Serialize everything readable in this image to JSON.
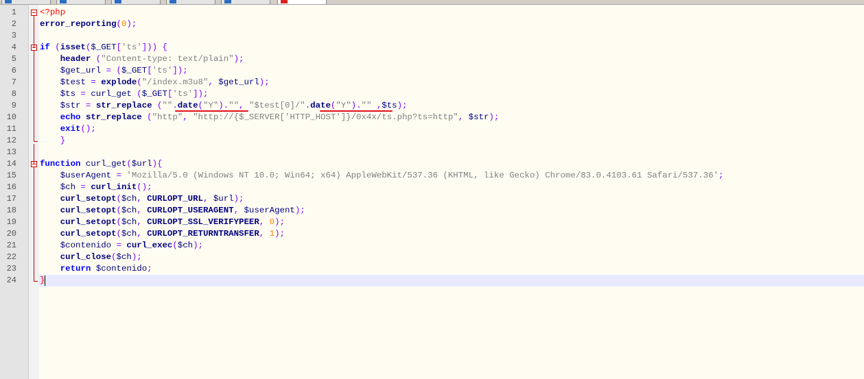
{
  "editor": {
    "line_numbers": [
      "1",
      "2",
      "3",
      "4",
      "5",
      "6",
      "7",
      "8",
      "9",
      "10",
      "11",
      "12",
      "13",
      "14",
      "15",
      "16",
      "17",
      "18",
      "19",
      "20",
      "21",
      "22",
      "23",
      "24"
    ],
    "lines": [
      [
        {
          "t": "<?php",
          "c": "tag"
        }
      ],
      [
        {
          "t": "error_reporting",
          "c": "bold"
        },
        {
          "t": "(",
          "c": "op"
        },
        {
          "t": "0",
          "c": "num"
        },
        {
          "t": ");",
          "c": "op"
        }
      ],
      [],
      [
        {
          "t": "if",
          "c": "kw"
        },
        {
          "t": " (",
          "c": "op"
        },
        {
          "t": "isset",
          "c": "bold"
        },
        {
          "t": "(",
          "c": "op"
        },
        {
          "t": "$_GET",
          "c": "var"
        },
        {
          "t": "[",
          "c": "op"
        },
        {
          "t": "'ts'",
          "c": "str"
        },
        {
          "t": "])) {",
          "c": "op"
        }
      ],
      [
        {
          "t": "    "
        },
        {
          "t": "header",
          "c": "bold"
        },
        {
          "t": " (",
          "c": "op"
        },
        {
          "t": "\"Content-type: text/plain\"",
          "c": "str"
        },
        {
          "t": ");",
          "c": "op"
        }
      ],
      [
        {
          "t": "    "
        },
        {
          "t": "$get_url",
          "c": "var"
        },
        {
          "t": " = (",
          "c": "op"
        },
        {
          "t": "$_GET",
          "c": "var"
        },
        {
          "t": "[",
          "c": "op"
        },
        {
          "t": "'ts'",
          "c": "str"
        },
        {
          "t": "]);",
          "c": "op"
        }
      ],
      [
        {
          "t": "    "
        },
        {
          "t": "$test",
          "c": "var"
        },
        {
          "t": " = ",
          "c": "op"
        },
        {
          "t": "explode",
          "c": "bold"
        },
        {
          "t": "(",
          "c": "op"
        },
        {
          "t": "\"/index.m3u8\"",
          "c": "str"
        },
        {
          "t": ", ",
          "c": "op"
        },
        {
          "t": "$get_url",
          "c": "var"
        },
        {
          "t": ");",
          "c": "op"
        }
      ],
      [
        {
          "t": "    "
        },
        {
          "t": "$ts",
          "c": "var"
        },
        {
          "t": " = ",
          "c": "op"
        },
        {
          "t": "curl_get",
          "c": "fn"
        },
        {
          "t": " (",
          "c": "op"
        },
        {
          "t": "$_GET",
          "c": "var"
        },
        {
          "t": "[",
          "c": "op"
        },
        {
          "t": "'ts'",
          "c": "str"
        },
        {
          "t": "]);",
          "c": "op"
        }
      ],
      [
        {
          "t": "    "
        },
        {
          "t": "$str",
          "c": "var"
        },
        {
          "t": " = ",
          "c": "op"
        },
        {
          "t": "str_replace",
          "c": "bold"
        },
        {
          "t": " (",
          "c": "op"
        },
        {
          "t": "\"\"",
          "c": "str"
        },
        {
          "t": ".",
          "c": "op"
        },
        {
          "t": "date",
          "c": "bold"
        },
        {
          "t": "(",
          "c": "op"
        },
        {
          "t": "\"Y\"",
          "c": "str"
        },
        {
          "t": ").",
          "c": "op"
        },
        {
          "t": "\"\"",
          "c": "str"
        },
        {
          "t": ", ",
          "c": "op"
        },
        {
          "t": "\"$test[0]/\"",
          "c": "str"
        },
        {
          "t": ".",
          "c": "op"
        },
        {
          "t": "date",
          "c": "bold"
        },
        {
          "t": "(",
          "c": "op"
        },
        {
          "t": "\"Y\"",
          "c": "str"
        },
        {
          "t": ").",
          "c": "op"
        },
        {
          "t": "\"\"",
          "c": "str"
        },
        {
          "t": " ,",
          "c": "op"
        },
        {
          "t": "$ts",
          "c": "var"
        },
        {
          "t": ");",
          "c": "op"
        }
      ],
      [
        {
          "t": "    "
        },
        {
          "t": "echo",
          "c": "kw"
        },
        {
          "t": " "
        },
        {
          "t": "str_replace",
          "c": "bold"
        },
        {
          "t": " (",
          "c": "op"
        },
        {
          "t": "\"http\"",
          "c": "str"
        },
        {
          "t": ", ",
          "c": "op"
        },
        {
          "t": "\"http://{$_SERVER['HTTP_HOST']}/0x4x/ts.php?ts=http\"",
          "c": "str"
        },
        {
          "t": ", ",
          "c": "op"
        },
        {
          "t": "$str",
          "c": "var"
        },
        {
          "t": ");",
          "c": "op"
        }
      ],
      [
        {
          "t": "    "
        },
        {
          "t": "exit",
          "c": "kw"
        },
        {
          "t": "();",
          "c": "op"
        }
      ],
      [
        {
          "t": "    "
        },
        {
          "t": "}",
          "c": "op"
        }
      ],
      [],
      [
        {
          "t": "function",
          "c": "kw"
        },
        {
          "t": " curl_get",
          "c": "fn"
        },
        {
          "t": "(",
          "c": "op"
        },
        {
          "t": "$url",
          "c": "var"
        },
        {
          "t": "){",
          "c": "op"
        }
      ],
      [
        {
          "t": "    "
        },
        {
          "t": "$userAgent",
          "c": "var"
        },
        {
          "t": " = ",
          "c": "op"
        },
        {
          "t": "'Mozilla/5.0 (Windows NT 10.0; Win64; x64) AppleWebKit/537.36 (KHTML, like Gecko) Chrome/83.0.4103.61 Safari/537.36'",
          "c": "str"
        },
        {
          "t": ";",
          "c": "op"
        }
      ],
      [
        {
          "t": "    "
        },
        {
          "t": "$ch",
          "c": "var"
        },
        {
          "t": " = ",
          "c": "op"
        },
        {
          "t": "curl_init",
          "c": "bold"
        },
        {
          "t": "();",
          "c": "op"
        }
      ],
      [
        {
          "t": "    "
        },
        {
          "t": "curl_setopt",
          "c": "bold"
        },
        {
          "t": "(",
          "c": "op"
        },
        {
          "t": "$ch",
          "c": "var"
        },
        {
          "t": ", ",
          "c": "op"
        },
        {
          "t": "CURLOPT_URL",
          "c": "bold"
        },
        {
          "t": ", ",
          "c": "op"
        },
        {
          "t": "$url",
          "c": "var"
        },
        {
          "t": ");",
          "c": "op"
        }
      ],
      [
        {
          "t": "    "
        },
        {
          "t": "curl_setopt",
          "c": "bold"
        },
        {
          "t": "(",
          "c": "op"
        },
        {
          "t": "$ch",
          "c": "var"
        },
        {
          "t": ", ",
          "c": "op"
        },
        {
          "t": "CURLOPT_USERAGENT",
          "c": "bold"
        },
        {
          "t": ", ",
          "c": "op"
        },
        {
          "t": "$userAgent",
          "c": "var"
        },
        {
          "t": ");",
          "c": "op"
        }
      ],
      [
        {
          "t": "    "
        },
        {
          "t": "curl_setopt",
          "c": "bold"
        },
        {
          "t": "(",
          "c": "op"
        },
        {
          "t": "$ch",
          "c": "var"
        },
        {
          "t": ", ",
          "c": "op"
        },
        {
          "t": "CURLOPT_SSL_VERIFYPEER",
          "c": "bold"
        },
        {
          "t": ", ",
          "c": "op"
        },
        {
          "t": "0",
          "c": "num"
        },
        {
          "t": ");",
          "c": "op"
        }
      ],
      [
        {
          "t": "    "
        },
        {
          "t": "curl_setopt",
          "c": "bold"
        },
        {
          "t": "(",
          "c": "op"
        },
        {
          "t": "$ch",
          "c": "var"
        },
        {
          "t": ", ",
          "c": "op"
        },
        {
          "t": "CURLOPT_RETURNTRANSFER",
          "c": "bold"
        },
        {
          "t": ", ",
          "c": "op"
        },
        {
          "t": "1",
          "c": "num"
        },
        {
          "t": ");",
          "c": "op"
        }
      ],
      [
        {
          "t": "    "
        },
        {
          "t": "$contenido",
          "c": "var"
        },
        {
          "t": " = ",
          "c": "op"
        },
        {
          "t": "curl_exec",
          "c": "bold"
        },
        {
          "t": "(",
          "c": "op"
        },
        {
          "t": "$ch",
          "c": "var"
        },
        {
          "t": ");",
          "c": "op"
        }
      ],
      [
        {
          "t": "    "
        },
        {
          "t": "curl_close",
          "c": "bold"
        },
        {
          "t": "(",
          "c": "op"
        },
        {
          "t": "$ch",
          "c": "var"
        },
        {
          "t": ");",
          "c": "op"
        }
      ],
      [
        {
          "t": "    "
        },
        {
          "t": "return",
          "c": "kw"
        },
        {
          "t": " "
        },
        {
          "t": "$contenido",
          "c": "var"
        },
        {
          "t": ";",
          "c": "op"
        }
      ],
      [
        {
          "t": "}",
          "c": "tag"
        }
      ]
    ],
    "current_line": 24,
    "colors": {
      "background": "#fffdf2",
      "gutter": "#e4e4e4",
      "current_line": "#e8e8ff",
      "fold_marker": "#cc0000",
      "underline": "#e0101a"
    },
    "fold_points": [
      {
        "line": 1,
        "icon": "fold-minus-icon"
      },
      {
        "line": 4,
        "icon": "fold-minus-icon"
      },
      {
        "line": 14,
        "icon": "fold-minus-icon"
      }
    ]
  }
}
